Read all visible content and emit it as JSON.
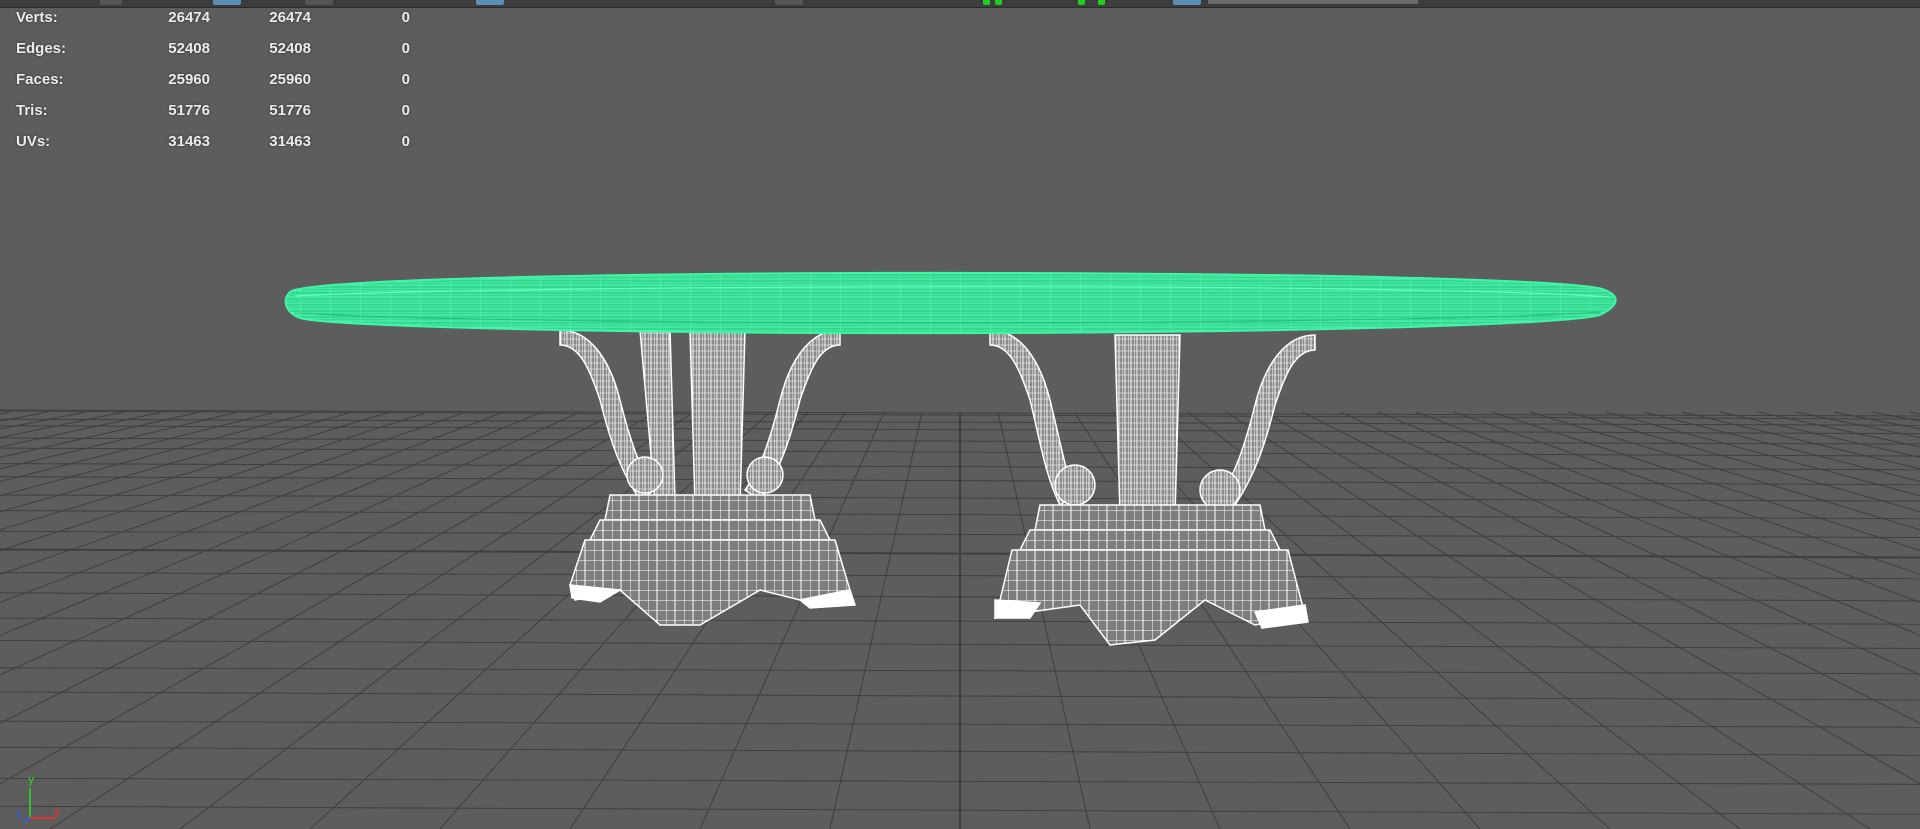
{
  "hud": {
    "rows": [
      {
        "label": "Verts:",
        "c1": "26474",
        "c2": "26474",
        "c3": "0"
      },
      {
        "label": "Edges:",
        "c1": "52408",
        "c2": "52408",
        "c3": "0"
      },
      {
        "label": "Faces:",
        "c1": "25960",
        "c2": "25960",
        "c3": "0"
      },
      {
        "label": "Tris:",
        "c1": "51776",
        "c2": "51776",
        "c3": "0"
      },
      {
        "label": "UVs:",
        "c1": "31463",
        "c2": "31463",
        "c3": "0"
      }
    ]
  },
  "axis": {
    "y": "y",
    "z": "z",
    "x": "x"
  },
  "colors": {
    "background": "#5d5d5d",
    "grid": "#3f3f3f",
    "selected_wire": "#40f5a8",
    "wire": "#ffffff",
    "axis_x": "#e03030",
    "axis_y": "#30c030",
    "axis_z": "#3060e0"
  },
  "icons": [
    "axis-gizmo-icon"
  ]
}
